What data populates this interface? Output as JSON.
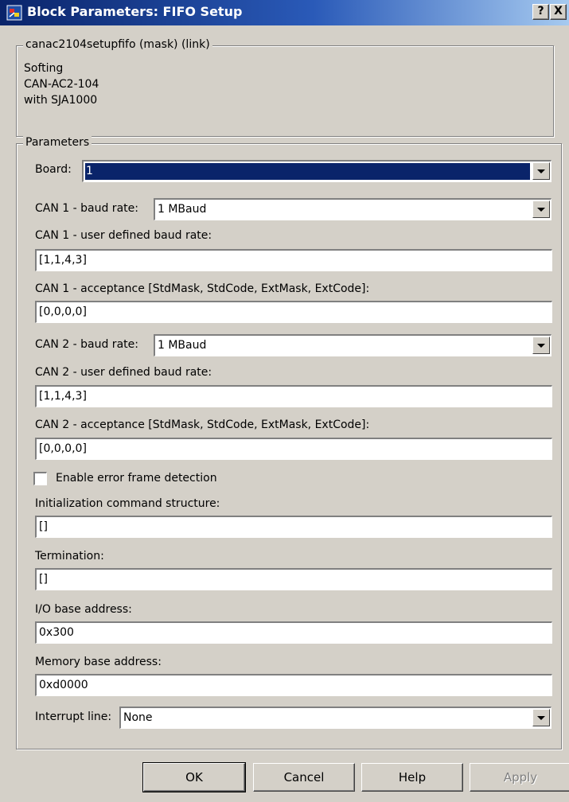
{
  "window": {
    "title": "Block Parameters: FIFO Setup",
    "help_button": "?",
    "close_button": "X"
  },
  "description": {
    "legend": "canac2104setupfifo (mask) (link)",
    "lines": [
      "Softing",
      "CAN-AC2-104",
      "with SJA1000"
    ]
  },
  "parameters": {
    "legend": "Parameters",
    "board": {
      "label": "Board:",
      "value": "1"
    },
    "can1_baud_rate": {
      "label": "CAN 1 - baud rate:",
      "value": "1 MBaud"
    },
    "can1_user_baud": {
      "label": "CAN 1 - user defined baud rate:",
      "value": "[1,1,4,3]"
    },
    "can1_acceptance": {
      "label": "CAN 1 - acceptance [StdMask, StdCode, ExtMask, ExtCode]:",
      "value": "[0,0,0,0]"
    },
    "can2_baud_rate": {
      "label": "CAN 2 - baud rate:",
      "value": "1 MBaud"
    },
    "can2_user_baud": {
      "label": "CAN 2 - user defined baud rate:",
      "value": "[1,1,4,3]"
    },
    "can2_acceptance": {
      "label": "CAN 2 - acceptance [StdMask, StdCode, ExtMask, ExtCode]:",
      "value": "[0,0,0,0]"
    },
    "error_frame": {
      "label": "Enable error frame detection",
      "checked": false
    },
    "init_command": {
      "label": "Initialization command structure:",
      "value": "[]"
    },
    "termination": {
      "label": "Termination:",
      "value": "[]"
    },
    "io_base": {
      "label": "I/O base address:",
      "value": "0x300"
    },
    "mem_base": {
      "label": "Memory base address:",
      "value": "0xd0000"
    },
    "interrupt_line": {
      "label": "Interrupt line:",
      "value": "None"
    }
  },
  "buttons": {
    "ok": "OK",
    "cancel": "Cancel",
    "help": "Help",
    "apply": "Apply"
  }
}
